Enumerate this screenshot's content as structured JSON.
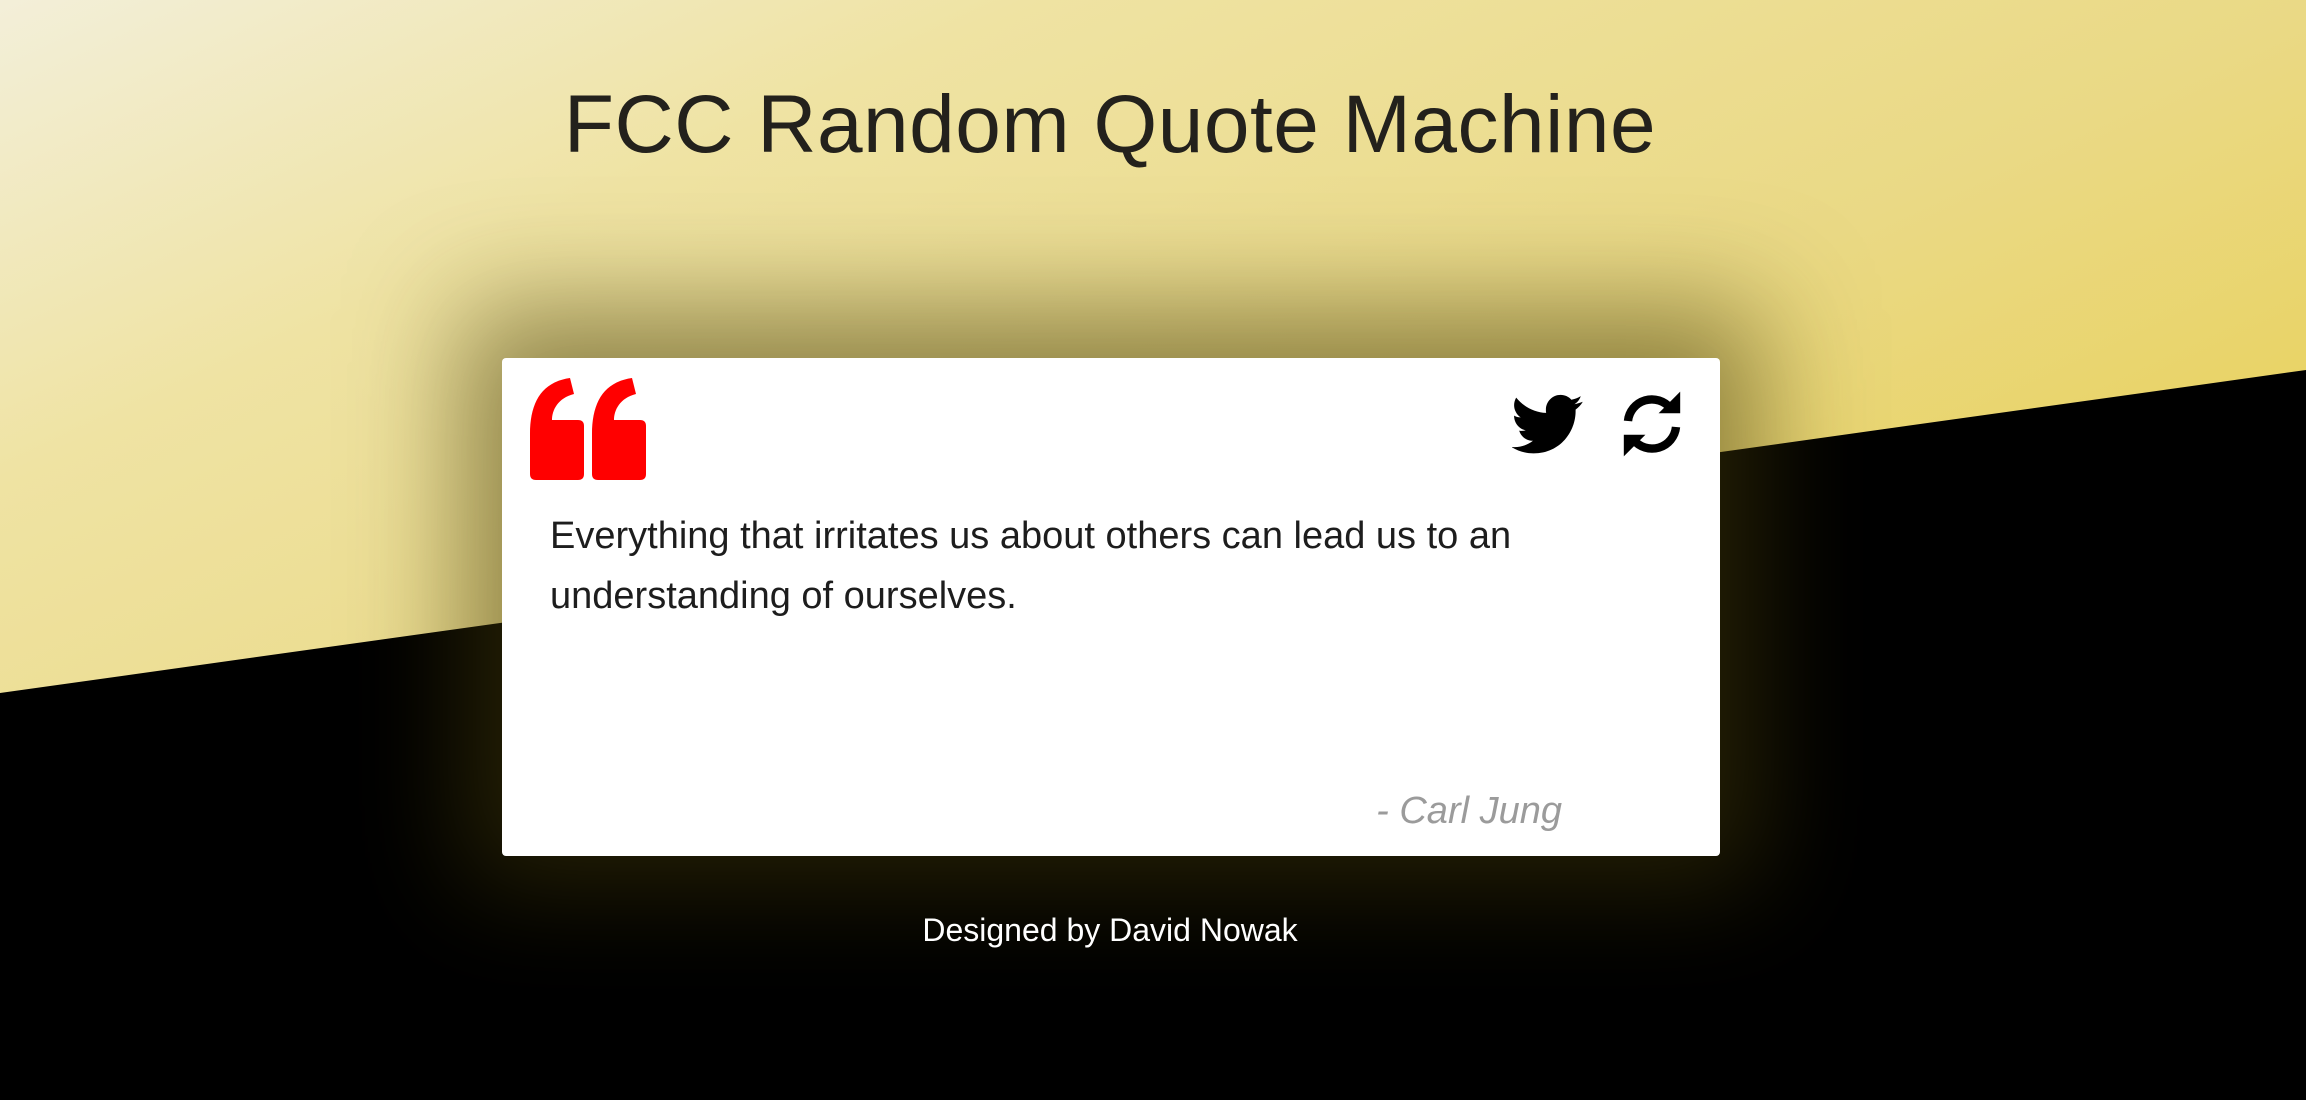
{
  "page": {
    "title": "FCC Random Quote Machine",
    "footer": "Designed by David Nowak"
  },
  "quote": {
    "text": "Everything that irritates us about others can lead us to an understanding of ourselves.",
    "author": "- Carl Jung"
  },
  "icons": {
    "quote_mark": "quote-mark-icon",
    "tweet": "twitter-icon",
    "refresh": "refresh-icon"
  },
  "colors": {
    "quote_mark": "#ff0000",
    "background_dark": "#000000",
    "background_gold": "#e8cf4e",
    "author_text": "#9b9b9b"
  }
}
